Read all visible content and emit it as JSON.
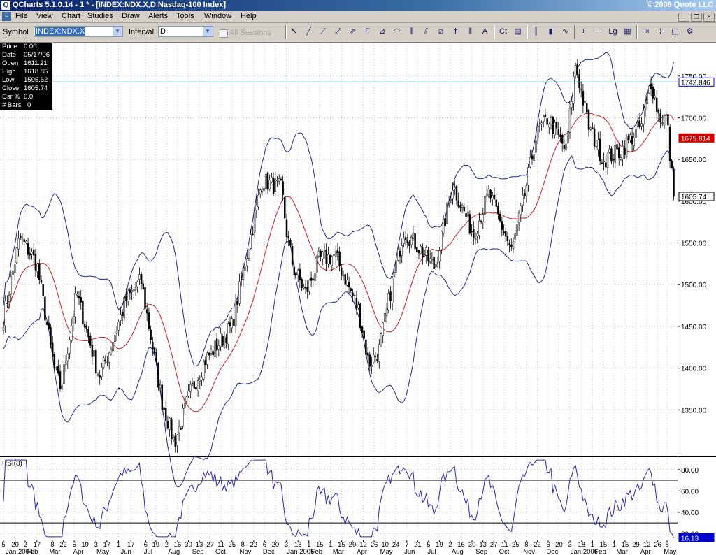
{
  "window": {
    "title": "QCharts 5.1.0.14 - 1 * - [INDEX:NDX.X,D Nasdaq-100 Index]",
    "copyright": "© 2006 Quote LLC"
  },
  "menu": [
    "File",
    "View",
    "Chart",
    "Studies",
    "Draw",
    "Alerts",
    "Tools",
    "Window",
    "Help"
  ],
  "window_buttons": [
    "_",
    "❐",
    "×"
  ],
  "toolbar": {
    "symbol_label": "Symbol",
    "symbol_value": "INDEX:NDX.X",
    "interval_label": "Interval",
    "interval_value": "D",
    "sessions_label": "All Sessions",
    "sessions_checked": false,
    "tools": [
      {
        "icon": "pointer-icon",
        "glyph": "↖"
      },
      {
        "icon": "trendline-icon",
        "glyph": "╱"
      },
      {
        "icon": "ray-icon",
        "glyph": "⟋"
      },
      {
        "icon": "line-extend-icon",
        "glyph": "⤢"
      },
      {
        "icon": "arrow-icon",
        "glyph": "⇗"
      },
      {
        "icon": "fibonacci-icon",
        "glyph": "F"
      },
      {
        "icon": "fib-fan-icon",
        "glyph": "⊿"
      },
      {
        "icon": "fib-arcs-icon",
        "glyph": "◠"
      },
      {
        "icon": "gann-icon",
        "glyph": "⫼"
      },
      {
        "icon": "channel-icon",
        "glyph": "⫽"
      },
      {
        "icon": "regression-icon",
        "glyph": "⧄"
      },
      {
        "icon": "pitchfork-icon",
        "glyph": "⋔"
      },
      {
        "icon": "cycle-lines-icon",
        "glyph": "⦀"
      },
      {
        "icon": "text-tool-icon",
        "glyph": "A"
      },
      {
        "icon": "ct-icon",
        "glyph": "Ct"
      },
      {
        "icon": "print-icon",
        "glyph": "▤"
      },
      {
        "icon": "bar-chart-icon",
        "glyph": "┃"
      },
      {
        "icon": "candle-chart-icon",
        "glyph": "▮"
      },
      {
        "icon": "line-chart-icon",
        "glyph": "∿"
      },
      {
        "icon": "zoom-in-icon",
        "glyph": "+"
      },
      {
        "icon": "zoom-out-icon",
        "glyph": "−"
      },
      {
        "icon": "log-scale-icon",
        "glyph": "Lg"
      },
      {
        "icon": "grid-icon",
        "glyph": "▦"
      },
      {
        "icon": "scroll-right-icon",
        "glyph": "⇥"
      },
      {
        "icon": "crosshair-icon",
        "glyph": "⊹"
      },
      {
        "icon": "detach-icon",
        "glyph": "◫"
      },
      {
        "icon": "properties-icon",
        "glyph": "⚙"
      }
    ]
  },
  "quote_box": {
    "rows": [
      {
        "label": "Price",
        "value": "0.00"
      },
      {
        "label": "Date",
        "value": "05/17/06"
      },
      {
        "label": "Open",
        "value": "1611.21"
      },
      {
        "label": "High",
        "value": "1618.85"
      },
      {
        "label": "Low",
        "value": "1595.62"
      },
      {
        "label": "Close",
        "value": "1605.74"
      },
      {
        "label": "Csr %",
        "value": "0.0"
      },
      {
        "label": "# Bars",
        "value": "0"
      }
    ]
  },
  "colors": {
    "candle_up": "#ffffff",
    "candle_down": "#000000",
    "wick": "#000000",
    "bollinger": "#1c2a8c",
    "moving_average": "#c62020",
    "horizontal_line": "#4a8a9a",
    "rsi_line": "#2a2ab0",
    "grid": "#c8c8c8",
    "last_price_tag": "#0000cc",
    "ma_tag": "#cc0000"
  },
  "chart_data": [
    {
      "type": "candlestick",
      "title": "",
      "instrument": "INDEX:NDX.X,D Nasdaq-100 Index",
      "y_range": [
        1295,
        1790
      ],
      "y_ticks": [
        1350,
        1400,
        1450,
        1500,
        1550,
        1600,
        1650,
        1700,
        1750
      ],
      "y_tick_labels": [
        "1350.00",
        "1400.00",
        "1450.00",
        "1500.00",
        "1550.00",
        "1600.00",
        "1650.00",
        "1700.00",
        "1750.00"
      ],
      "grid": true,
      "horizontal_line": 1742.846,
      "axis_tags": [
        {
          "label": "1742.846",
          "value": 1742.846,
          "style": "outline"
        },
        {
          "label": "1675.814",
          "value": 1675.814,
          "style": "ma"
        },
        {
          "label": "1605.74",
          "value": 1605.74,
          "style": "last"
        }
      ],
      "overlays": [
        "Bollinger Bands (upper/lower)",
        "Moving Average"
      ],
      "close_path": [
        [
          "2004-01-05",
          1460
        ],
        [
          "2004-01-26",
          1557
        ],
        [
          "2004-02-17",
          1525
        ],
        [
          "2004-03-10",
          1400
        ],
        [
          "2004-03-19",
          1375
        ],
        [
          "2004-04-08",
          1490
        ],
        [
          "2004-05-07",
          1390
        ],
        [
          "2004-05-20",
          1420
        ],
        [
          "2004-06-10",
          1480
        ],
        [
          "2004-06-30",
          1505
        ],
        [
          "2004-07-27",
          1360
        ],
        [
          "2004-08-12",
          1310
        ],
        [
          "2004-09-01",
          1370
        ],
        [
          "2004-09-21",
          1410
        ],
        [
          "2004-10-25",
          1450
        ],
        [
          "2004-12-03",
          1625
        ],
        [
          "2004-12-28",
          1615
        ],
        [
          "2005-01-03",
          1565
        ],
        [
          "2005-01-12",
          1520
        ],
        [
          "2005-01-28",
          1490
        ],
        [
          "2005-02-14",
          1530
        ],
        [
          "2005-03-07",
          1535
        ],
        [
          "2005-04-06",
          1470
        ],
        [
          "2005-04-19",
          1405
        ],
        [
          "2005-05-02",
          1420
        ],
        [
          "2005-05-19",
          1500
        ],
        [
          "2005-06-03",
          1565
        ],
        [
          "2005-06-27",
          1540
        ],
        [
          "2005-07-13",
          1520
        ],
        [
          "2005-07-27",
          1580
        ],
        [
          "2005-08-05",
          1620
        ],
        [
          "2005-09-01",
          1560
        ],
        [
          "2005-09-21",
          1610
        ],
        [
          "2005-10-05",
          1575
        ],
        [
          "2005-10-20",
          1540
        ],
        [
          "2005-11-04",
          1600
        ],
        [
          "2005-11-21",
          1680
        ],
        [
          "2005-12-06",
          1700
        ],
        [
          "2005-12-29",
          1660
        ],
        [
          "2006-01-10",
          1765
        ],
        [
          "2006-01-27",
          1690
        ],
        [
          "2006-02-15",
          1650
        ],
        [
          "2006-03-09",
          1660
        ],
        [
          "2006-04-05",
          1690
        ],
        [
          "2006-04-17",
          1745
        ],
        [
          "2006-04-28",
          1700
        ],
        [
          "2006-05-08",
          1700
        ],
        [
          "2006-05-12",
          1650
        ],
        [
          "2006-05-17",
          1605.74
        ]
      ]
    },
    {
      "type": "line",
      "title": "RSI(8)",
      "y_range": [
        15,
        91
      ],
      "y_ticks": [
        20,
        40,
        60,
        80
      ],
      "y_tick_labels": [
        "20.00",
        "40.00",
        "60.00",
        "80.00"
      ],
      "reference_lines": [
        70,
        30
      ],
      "last_value_tag": "16.13",
      "last_value": 16.13
    }
  ],
  "x_axis": {
    "ticks": [
      [
        "2004-01-05",
        "5"
      ],
      [
        "2004-01-20",
        "20"
      ],
      [
        "2004-02-02",
        "2"
      ],
      [
        "2004-02-17",
        "17"
      ],
      [
        "2004-03-08",
        "8"
      ],
      [
        "2004-03-22",
        "22"
      ],
      [
        "2004-04-05",
        "5"
      ],
      [
        "2004-04-19",
        "19"
      ],
      [
        "2004-05-03",
        "3"
      ],
      [
        "2004-05-17",
        "17"
      ],
      [
        "2004-06-01",
        "1"
      ],
      [
        "2004-06-17",
        "17"
      ],
      [
        "2004-07-06",
        "6"
      ],
      [
        "2004-07-19",
        "19"
      ],
      [
        "2004-08-02",
        "2"
      ],
      [
        "2004-08-16",
        "16"
      ],
      [
        "2004-08-30",
        "30"
      ],
      [
        "2004-09-13",
        "13"
      ],
      [
        "2004-09-27",
        "27"
      ],
      [
        "2004-10-11",
        "11"
      ],
      [
        "2004-10-25",
        "25"
      ],
      [
        "2004-11-08",
        "8"
      ],
      [
        "2004-11-22",
        "22"
      ],
      [
        "2004-12-06",
        "6"
      ],
      [
        "2004-12-20",
        "20"
      ],
      [
        "2005-01-03",
        "3"
      ],
      [
        "2005-01-18",
        "18"
      ],
      [
        "2005-02-01",
        "1"
      ],
      [
        "2005-02-15",
        "15"
      ],
      [
        "2005-03-01",
        "1"
      ],
      [
        "2005-03-15",
        "15"
      ],
      [
        "2005-03-29",
        "29"
      ],
      [
        "2005-04-12",
        "12"
      ],
      [
        "2005-04-26",
        "26"
      ],
      [
        "2005-05-10",
        "10"
      ],
      [
        "2005-05-24",
        "24"
      ],
      [
        "2005-06-07",
        "7"
      ],
      [
        "2005-06-21",
        "21"
      ],
      [
        "2005-07-05",
        "5"
      ],
      [
        "2005-07-19",
        "19"
      ],
      [
        "2005-08-02",
        "2"
      ],
      [
        "2005-08-16",
        "16"
      ],
      [
        "2005-08-30",
        "30"
      ],
      [
        "2005-09-13",
        "13"
      ],
      [
        "2005-09-27",
        "27"
      ],
      [
        "2005-10-11",
        "11"
      ],
      [
        "2005-10-25",
        "25"
      ],
      [
        "2005-11-08",
        "8"
      ],
      [
        "2005-11-22",
        "22"
      ],
      [
        "2005-12-06",
        "6"
      ],
      [
        "2005-12-20",
        "20"
      ],
      [
        "2006-01-03",
        "3"
      ],
      [
        "2006-01-18",
        "18"
      ],
      [
        "2006-02-01",
        "1"
      ],
      [
        "2006-02-15",
        "15"
      ],
      [
        "2006-03-01",
        "1"
      ],
      [
        "2006-03-15",
        "15"
      ],
      [
        "2006-03-29",
        "29"
      ],
      [
        "2006-04-12",
        "12"
      ],
      [
        "2006-04-26",
        "26"
      ],
      [
        "2006-05-08",
        "8"
      ]
    ],
    "months": [
      [
        "2004-01-01",
        "Jan 2004"
      ],
      [
        "2004-02-01",
        "Feb"
      ],
      [
        "2004-03-01",
        "Mar"
      ],
      [
        "2004-04-01",
        "Apr"
      ],
      [
        "2004-05-01",
        "May"
      ],
      [
        "2004-06-01",
        "Jun"
      ],
      [
        "2004-07-01",
        "Jul"
      ],
      [
        "2004-08-01",
        "Aug"
      ],
      [
        "2004-09-01",
        "Sep"
      ],
      [
        "2004-10-01",
        "Oct"
      ],
      [
        "2004-11-01",
        "Nov"
      ],
      [
        "2004-12-01",
        "Dec"
      ],
      [
        "2005-01-01",
        "Jan 2005"
      ],
      [
        "2005-02-01",
        "Feb"
      ],
      [
        "2005-03-01",
        "Mar"
      ],
      [
        "2005-04-01",
        "Apr"
      ],
      [
        "2005-05-01",
        "May"
      ],
      [
        "2005-06-01",
        "Jun"
      ],
      [
        "2005-07-01",
        "Jul"
      ],
      [
        "2005-08-01",
        "Aug"
      ],
      [
        "2005-09-01",
        "Sep"
      ],
      [
        "2005-10-01",
        "Oct"
      ],
      [
        "2005-11-01",
        "Nov"
      ],
      [
        "2005-12-01",
        "Dec"
      ],
      [
        "2006-01-01",
        "Jan 2006"
      ],
      [
        "2006-02-01",
        "Feb"
      ],
      [
        "2006-03-01",
        "Mar"
      ],
      [
        "2006-04-01",
        "Apr"
      ],
      [
        "2006-05-01",
        "May"
      ]
    ]
  }
}
